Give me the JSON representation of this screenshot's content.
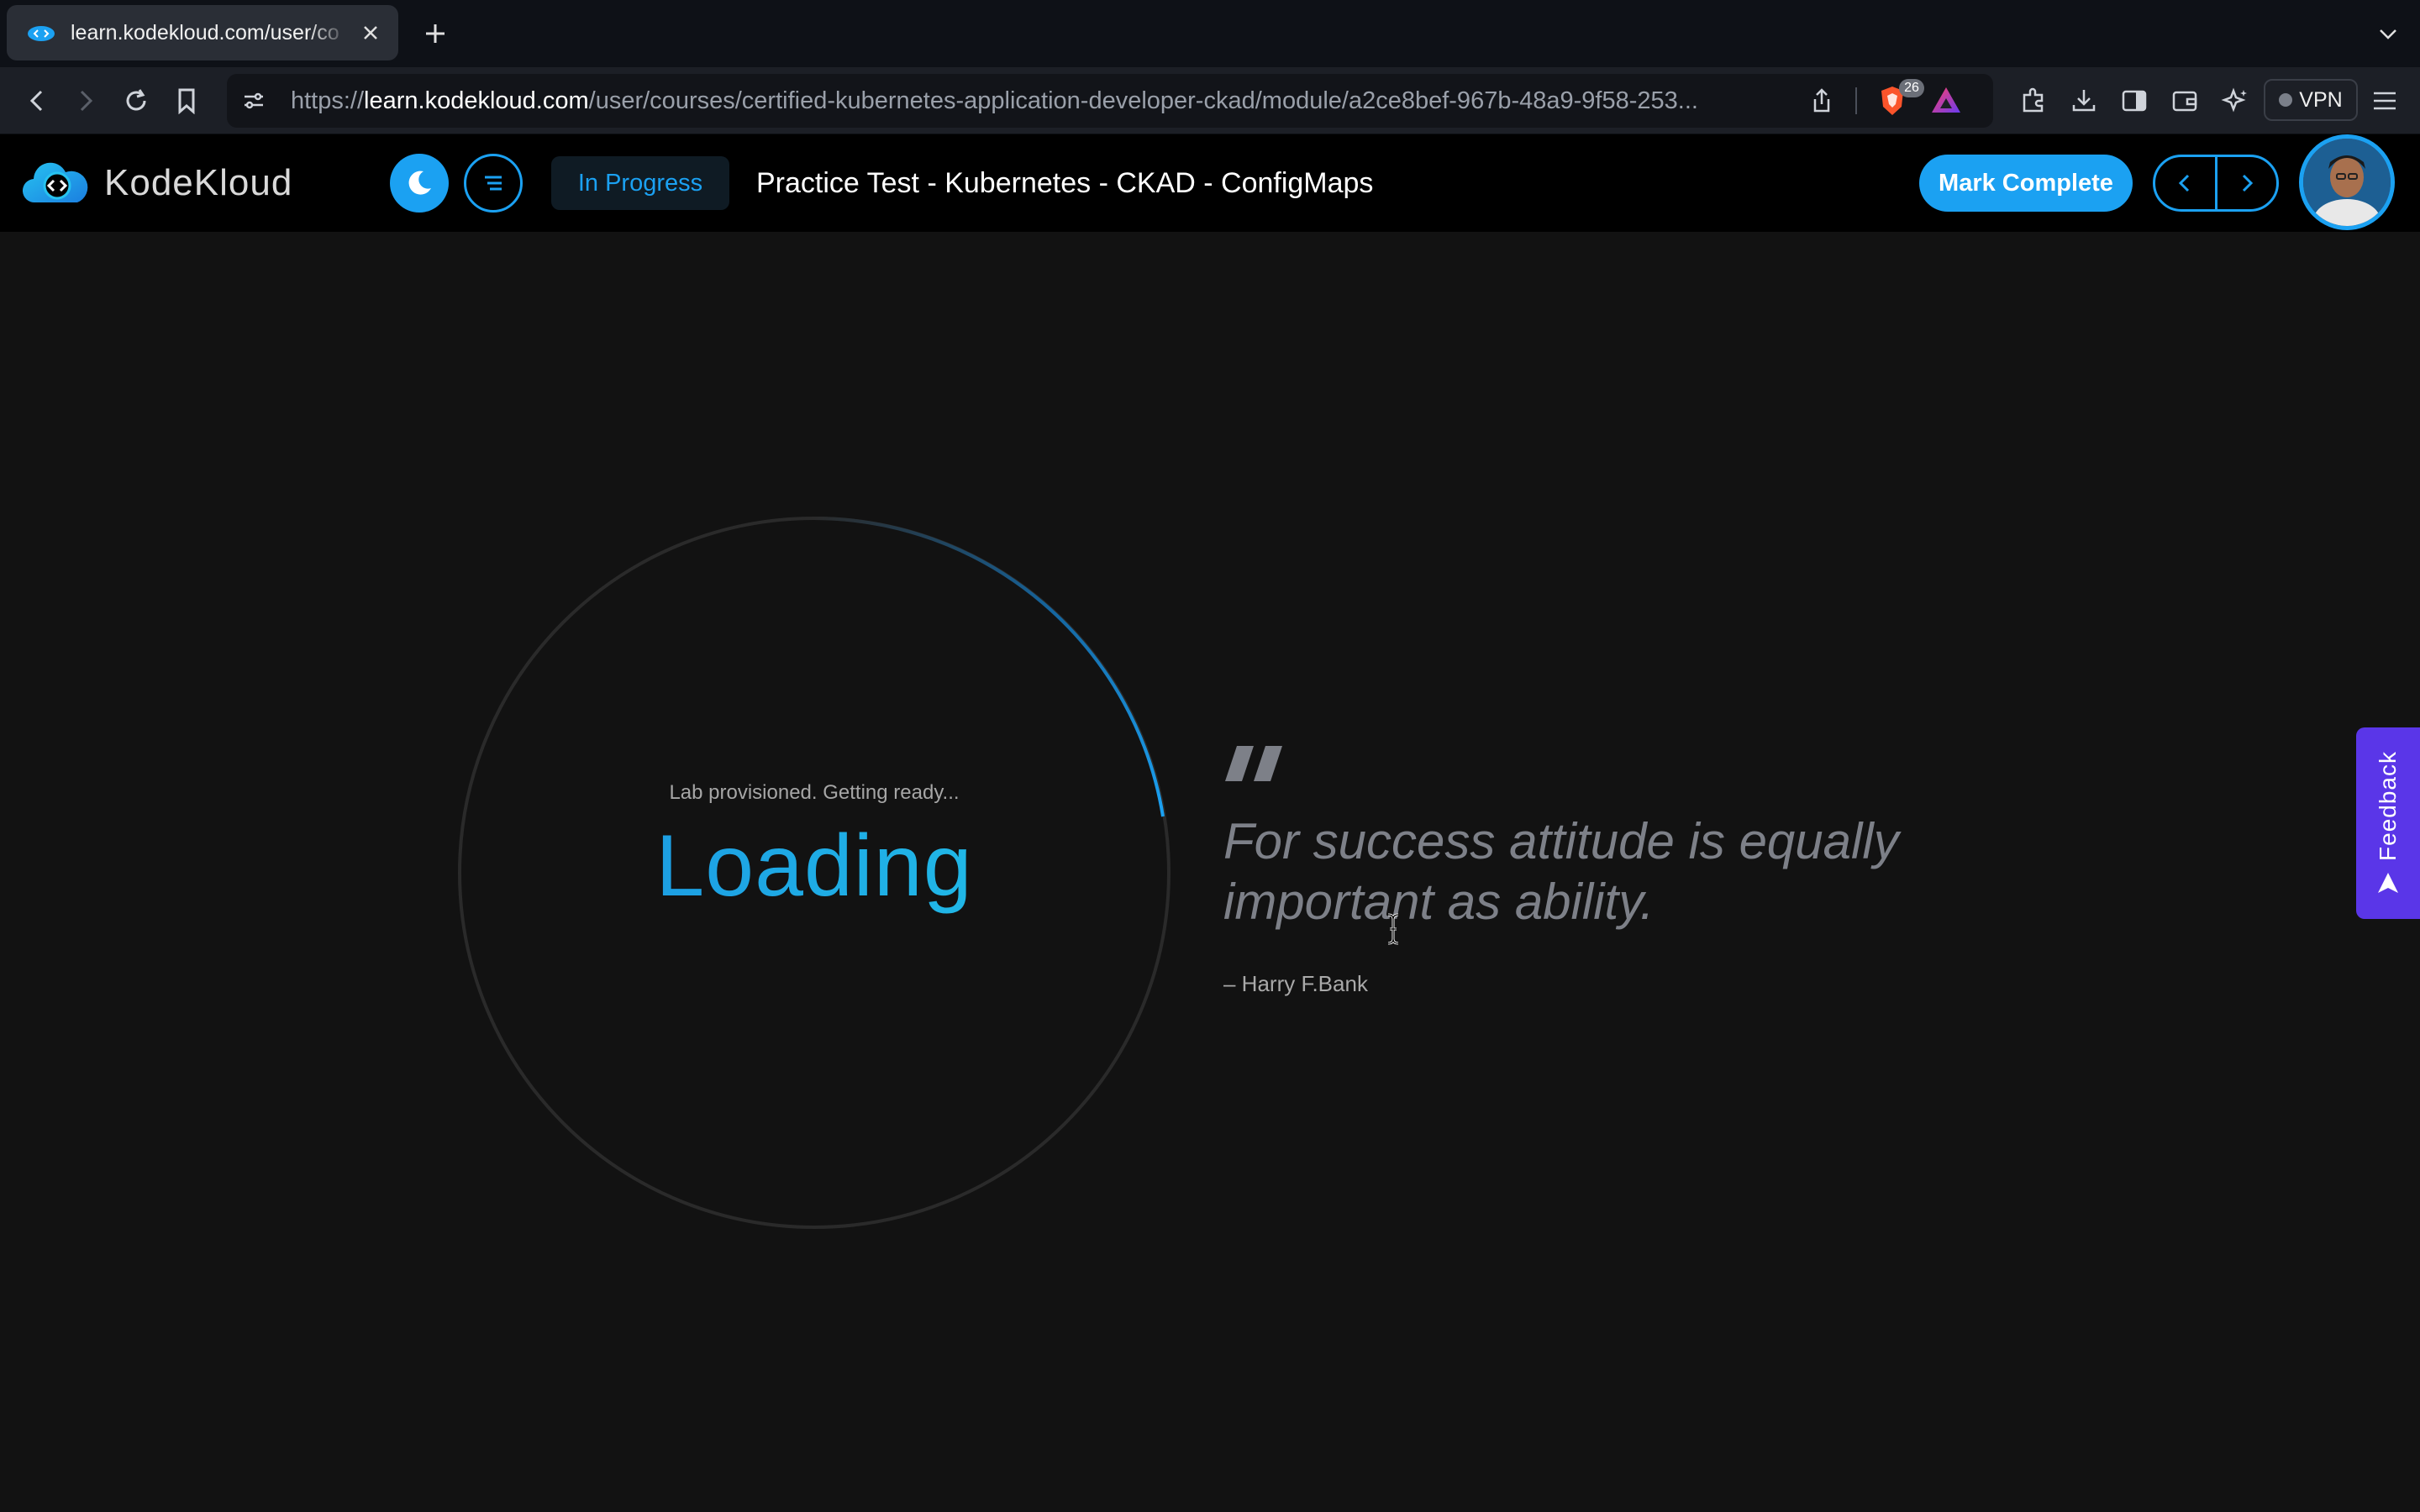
{
  "browser": {
    "tab_title": "learn.kodekloud.com/user/co",
    "url_scheme": "https://",
    "url_host": "learn.kodekloud.com",
    "url_path": "/user/courses/certified-kubernetes-application-developer-ckad/module/a2ce8bef-967b-48a9-9f58-253...",
    "shield_count": "26",
    "vpn_label": "VPN"
  },
  "header": {
    "brand": "KodeKloud",
    "status": "In Progress",
    "lesson_title": "Practice Test - Kubernetes - CKAD - ConfigMaps",
    "mark_complete_label": "Mark Complete"
  },
  "loader": {
    "status_text": "Lab provisioned. Getting ready...",
    "loading_label": "Loading"
  },
  "quote": {
    "text": "For success attitude is equally important as ability.",
    "author": "– Harry F.Bank"
  },
  "feedback": {
    "label": "Feedback"
  },
  "colors": {
    "accent": "#1ba1f2",
    "feedback": "#5a36e8",
    "background": "#121212"
  }
}
